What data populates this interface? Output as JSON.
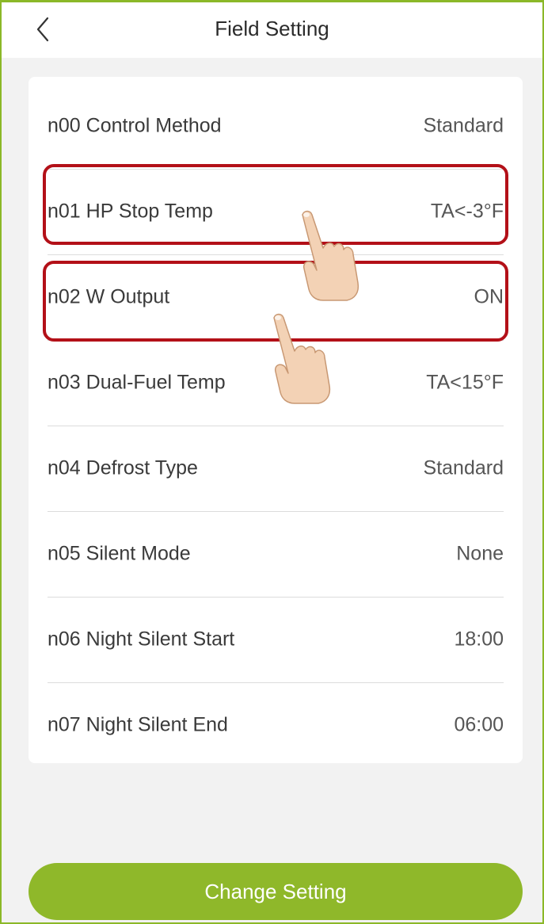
{
  "header": {
    "title": "Field Setting",
    "back_icon": "chevron-left-icon"
  },
  "settings": [
    {
      "label": "n00 Control Method",
      "value": "Standard"
    },
    {
      "label": "n01 HP Stop Temp",
      "value": "TA<-3°F"
    },
    {
      "label": "n02 W Output",
      "value": "ON"
    },
    {
      "label": "n03 Dual-Fuel Temp",
      "value": "TA<15°F"
    },
    {
      "label": "n04 Defrost Type",
      "value": "Standard"
    },
    {
      "label": "n05 Silent Mode",
      "value": "None"
    },
    {
      "label": "n06 Night Silent Start",
      "value": "18:00"
    },
    {
      "label": "n07 Night Silent End",
      "value": "06:00"
    }
  ],
  "footer": {
    "button_label": "Change Setting"
  },
  "colors": {
    "accent": "#8fb82a",
    "highlight": "#b31018",
    "background": "#f2f2f2"
  }
}
